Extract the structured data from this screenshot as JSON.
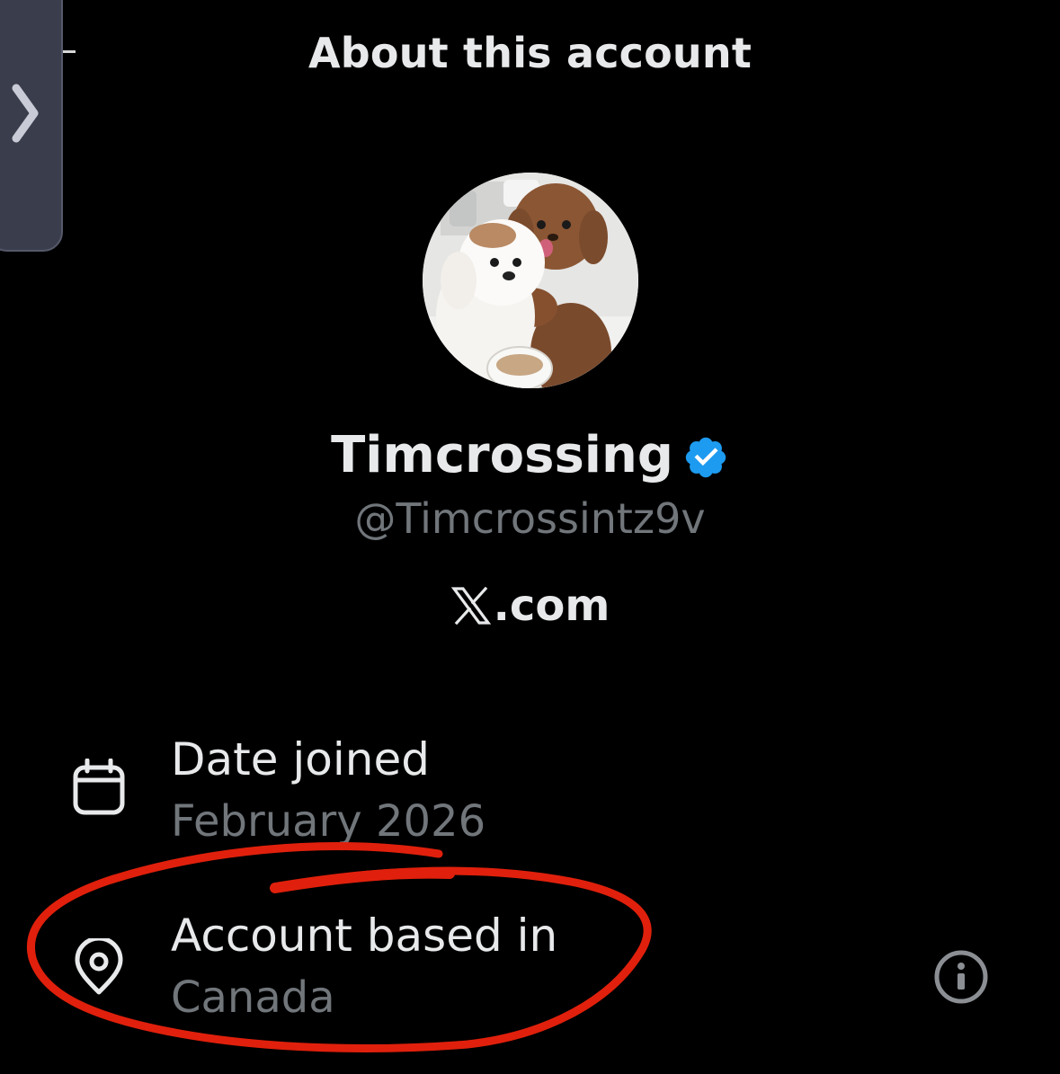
{
  "header": {
    "title": "About this account"
  },
  "profile": {
    "display_name": "Timcrossing",
    "handle": "@Timcrossintz9v",
    "verified": true,
    "avatar_description": "two-dogs-photo"
  },
  "source": {
    "logo": "x-logo",
    "label": ".com"
  },
  "details": [
    {
      "icon": "calendar-icon",
      "label": "Date joined",
      "value": "February 2026"
    },
    {
      "icon": "location-pin-icon",
      "label": "Account based in",
      "value": "Canada"
    }
  ],
  "colors": {
    "background": "#000000",
    "primary_text": "#e7e9ea",
    "secondary_text": "#71767b",
    "verified_blue": "#1d9bf0",
    "annotation_red": "#e0200c",
    "side_tab": "#3a3d4c"
  }
}
